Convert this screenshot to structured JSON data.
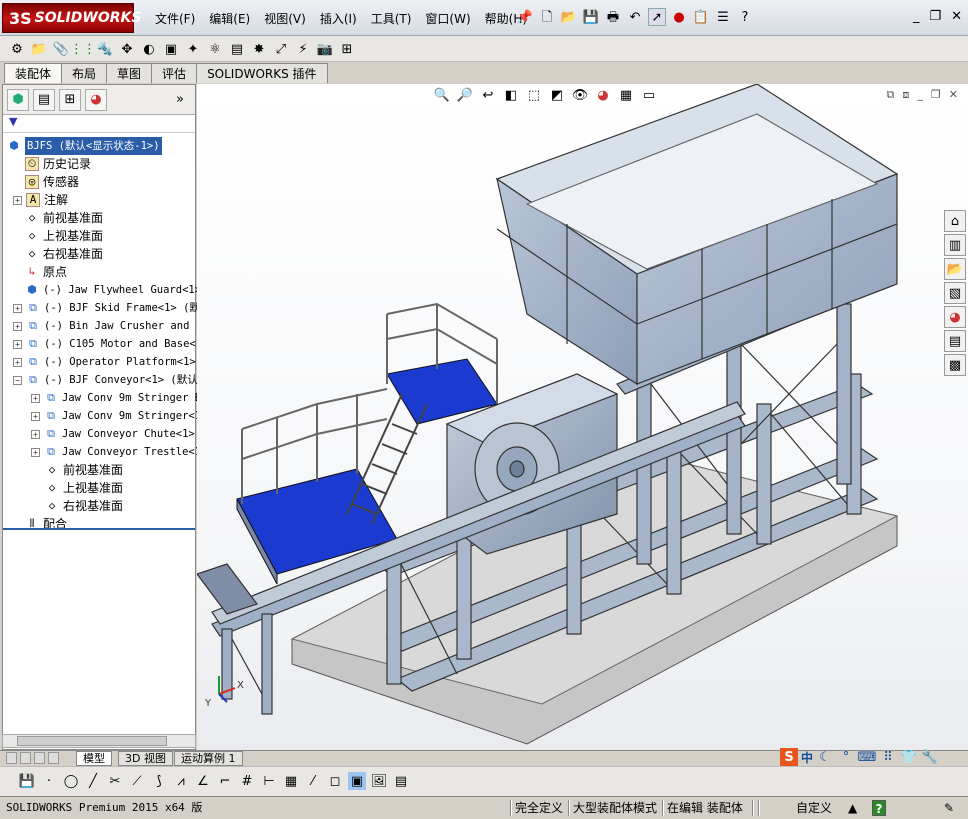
{
  "app": {
    "logo_prefix": "3S",
    "logo": "SOLIDWORKS"
  },
  "menu": [
    "文件(F)",
    "编辑(E)",
    "视图(V)",
    "插入(I)",
    "工具(T)",
    "窗口(W)",
    "帮助(H)"
  ],
  "tabs": [
    "装配体",
    "布局",
    "草图",
    "评估",
    "SOLIDWORKS 插件"
  ],
  "tree": {
    "root": "BJFS  (默认<显示状态-1>)",
    "items": [
      {
        "label": "历史记录",
        "icon": "history-icon"
      },
      {
        "label": "传感器",
        "icon": "sensor-icon"
      },
      {
        "label": "注解",
        "icon": "annotation-icon"
      },
      {
        "label": "前视基准面",
        "icon": "plane-icon"
      },
      {
        "label": "上视基准面",
        "icon": "plane-icon"
      },
      {
        "label": "右视基准面",
        "icon": "plane-icon"
      },
      {
        "label": "原点",
        "icon": "origin-icon"
      },
      {
        "label": "(-) Jaw Flywheel Guard<1>",
        "icon": "part-icon"
      },
      {
        "label": "(-) BJF Skid Frame<1> (默",
        "icon": "subassembly-icon"
      },
      {
        "label": "(-) Bin Jaw Crusher and F",
        "icon": "subassembly-icon"
      },
      {
        "label": "(-) C105 Motor and Base<1",
        "icon": "subassembly-icon"
      },
      {
        "label": "(-) Operator Platform<1>",
        "icon": "subassembly-icon"
      },
      {
        "label": "(-) BJF Conveyor<1> (默认",
        "icon": "subassembly-icon"
      },
      {
        "label": "Jaw Conv 9m Stringer B",
        "icon": "subassembly-icon"
      },
      {
        "label": "Jaw Conv 9m Stringer<1",
        "icon": "subassembly-icon"
      },
      {
        "label": "Jaw Conveyor Chute<1>",
        "icon": "subassembly-icon"
      },
      {
        "label": "Jaw Conveyor Trestle<1",
        "icon": "subassembly-icon"
      },
      {
        "label": "前视基准面",
        "icon": "plane-icon"
      },
      {
        "label": "上视基准面",
        "icon": "plane-icon"
      },
      {
        "label": "右视基准面",
        "icon": "plane-icon"
      },
      {
        "label": "配合",
        "icon": "mates-icon"
      }
    ]
  },
  "bottom_tabs": [
    "模型",
    "3D 视图",
    "运动算例 1"
  ],
  "axis": {
    "x": "X",
    "y": "Y"
  },
  "ime": {
    "lang": "中"
  },
  "status": {
    "product": "SOLIDWORKS Premium 2015 x64 版",
    "defined": "完全定义",
    "mode": "大型装配体模式",
    "editing": "在编辑 装配体",
    "units": "自定义",
    "help": "?"
  },
  "colors": {
    "accent": "#c41616",
    "selection": "#2b5ca8",
    "frame": "#a8b7cc",
    "platform": "#1a3ad0",
    "base": "#bdbdbd"
  }
}
